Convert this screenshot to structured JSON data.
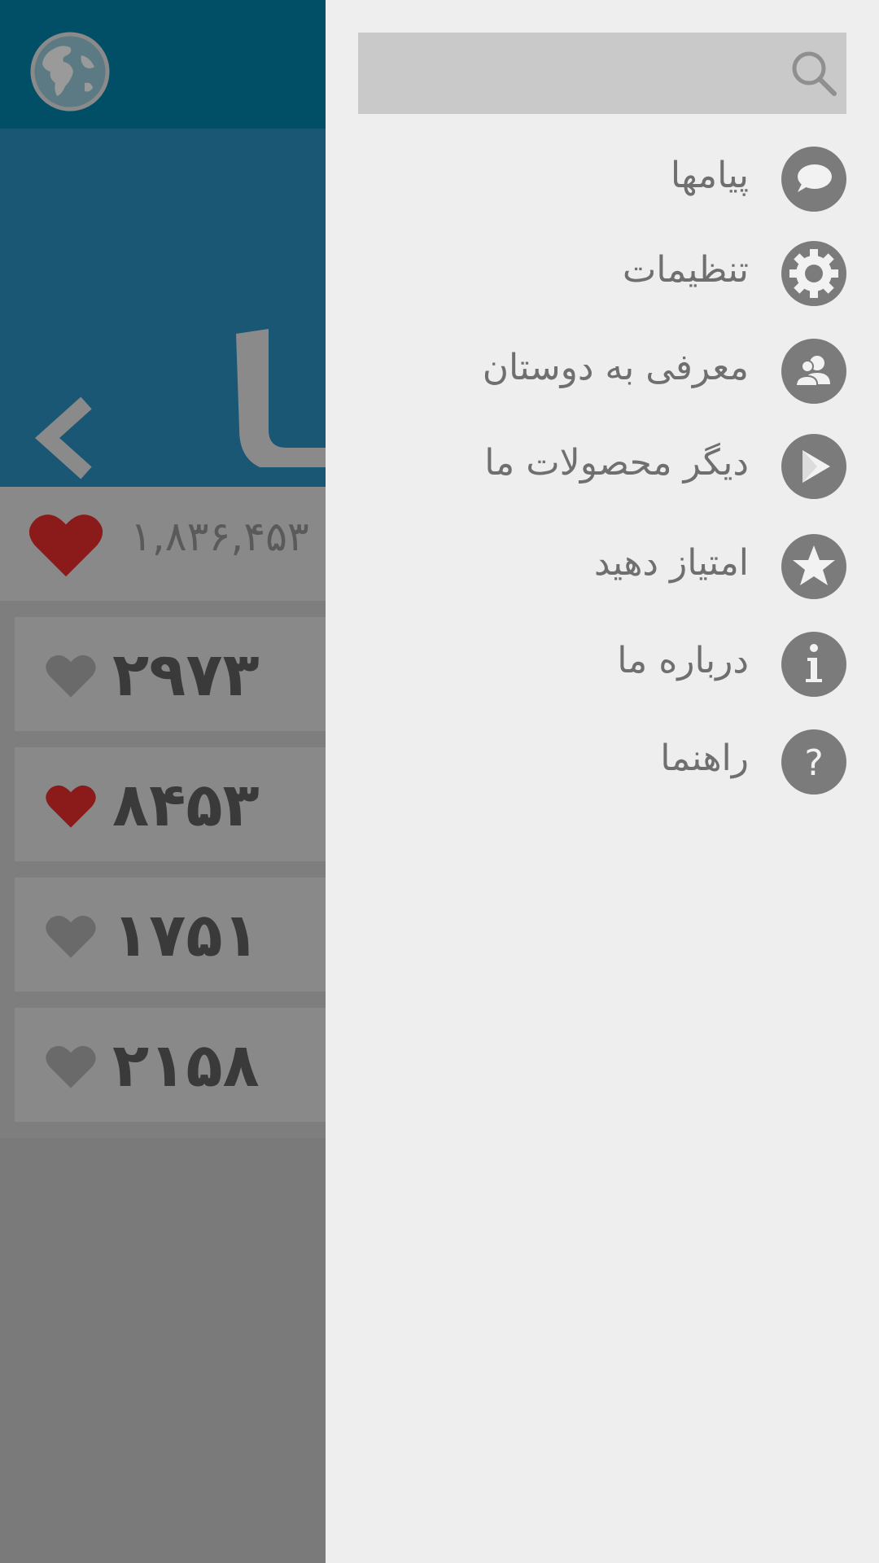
{
  "background": {
    "total_likes": "۱,۸۳۶,۴۵۳",
    "banner_glyph": "ا",
    "items": [
      {
        "count": "۲۹۷۳",
        "liked": false
      },
      {
        "count": "۸۴۵۳",
        "liked": true
      },
      {
        "count": "۱۷۵۱",
        "liked": false
      },
      {
        "count": "۲۱۵۸",
        "liked": false
      }
    ]
  },
  "drawer": {
    "search": {
      "placeholder": "",
      "icon": "search-icon"
    },
    "menu": [
      {
        "label": "پیامها",
        "icon": "chat-bubble-icon"
      },
      {
        "label": "تنظیمات",
        "icon": "gear-icon"
      },
      {
        "label": "معرفی به دوستان",
        "icon": "friends-icon"
      },
      {
        "label": "دیگر محصولات ما",
        "icon": "play-store-icon"
      },
      {
        "label": "امتیاز دهید",
        "icon": "star-icon"
      },
      {
        "label": "درباره ما",
        "icon": "info-icon"
      },
      {
        "label": "راهنما",
        "icon": "help-icon"
      }
    ]
  },
  "colors": {
    "topbar": "#004f67",
    "banner": "#1a5774",
    "heart_liked": "#8b1a1a",
    "heart_unliked": "#6a6a6a",
    "drawer_bg": "#eeeeef",
    "icon_circle": "#7b7b7b"
  }
}
